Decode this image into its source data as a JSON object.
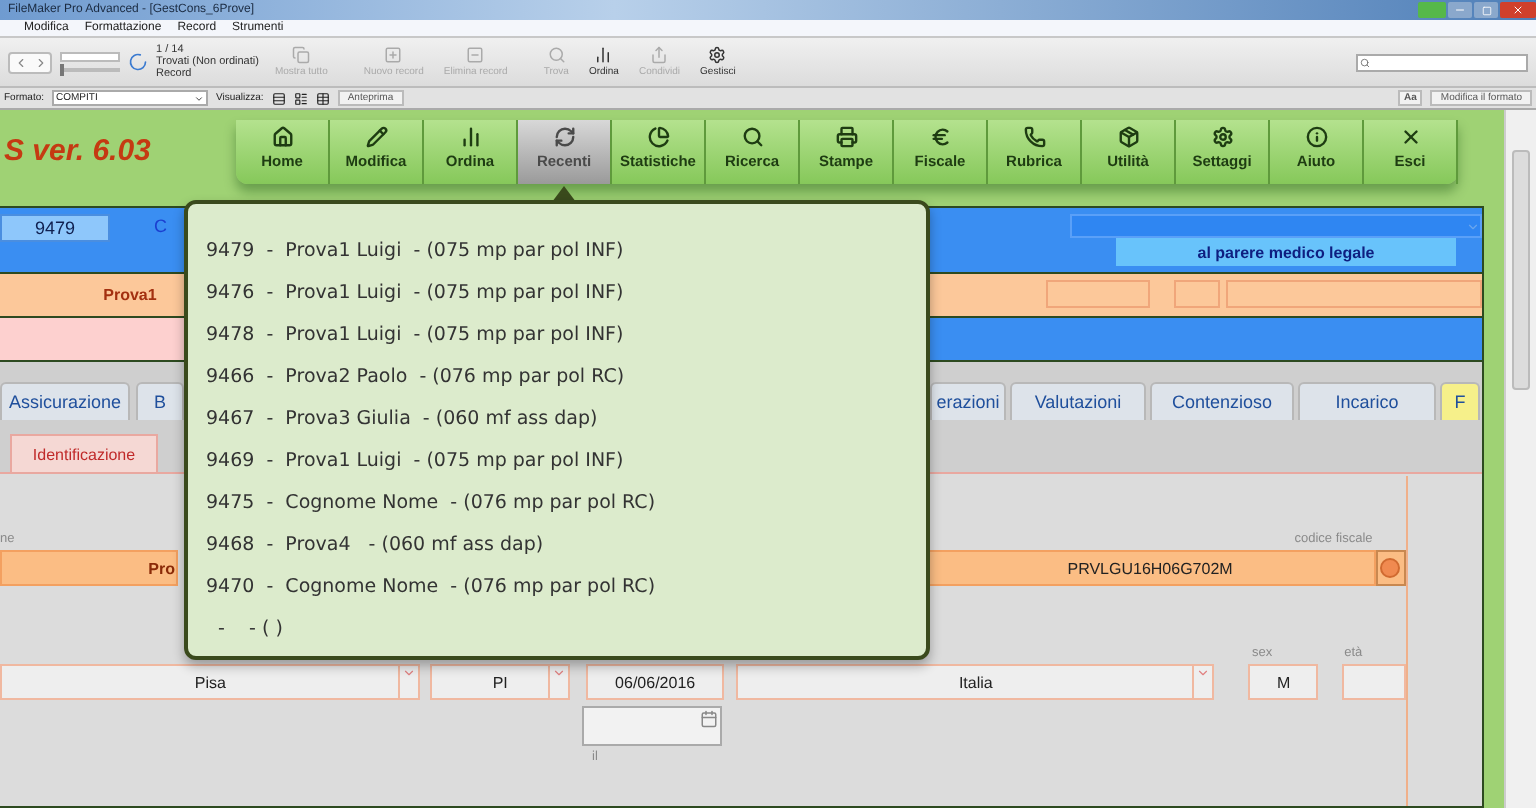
{
  "window": {
    "title": "FileMaker Pro Advanced - [GestCons_6Prove]"
  },
  "menu": [
    "Modifica",
    "Formattazione",
    "Record",
    "Strumenti"
  ],
  "toolbar": {
    "record": "1 / 14",
    "status": "Trovati (Non ordinati)",
    "record_label": "Record",
    "slider": {
      "level": 0
    },
    "buttons": [
      {
        "label": "Mostra tutto",
        "disabled": true
      },
      {
        "label": "Nuovo record",
        "disabled": true
      },
      {
        "label": "Elimina record",
        "disabled": true
      },
      {
        "label": "Trova",
        "disabled": true
      },
      {
        "label": "Ordina",
        "disabled": false
      },
      {
        "label": "Condividi",
        "disabled": true
      },
      {
        "label": "Gestisci",
        "disabled": false
      }
    ]
  },
  "format_bar": {
    "format_label": "Formato:",
    "format_value": "COMPITI",
    "view_label": "Visualizza:",
    "preview": "Anteprima",
    "font_button": "Aa",
    "edit_layout": "Modifica il formato"
  },
  "app": {
    "version": "S ver. 6.03",
    "nav": [
      {
        "label": "Home",
        "selected": false
      },
      {
        "label": "Modifica",
        "selected": false
      },
      {
        "label": "Ordina",
        "selected": false
      },
      {
        "label": "Recenti",
        "selected": true
      },
      {
        "label": "Statistiche",
        "selected": false
      },
      {
        "label": "Ricerca",
        "selected": false
      },
      {
        "label": "Stampe",
        "selected": false
      },
      {
        "label": "Fiscale",
        "selected": false
      },
      {
        "label": "Rubrica",
        "selected": false
      },
      {
        "label": "Utilità",
        "selected": false
      },
      {
        "label": "Settaggi",
        "selected": false
      },
      {
        "label": "Aiuto",
        "selected": false
      },
      {
        "label": "Esci",
        "selected": false
      }
    ]
  },
  "record_header": {
    "id": "9479",
    "label": "C",
    "note": "al parere medico legale",
    "name": "Prova1"
  },
  "tabs": [
    {
      "label": "Assicurazione",
      "selected": false
    },
    {
      "label": "B",
      "selected": false
    },
    {
      "label": "erazioni",
      "selected": false
    },
    {
      "label": "Valutazioni",
      "selected": false
    },
    {
      "label": "Contenzioso",
      "selected": false
    },
    {
      "label": "Incarico",
      "selected": false
    },
    {
      "label": "F",
      "selected": true
    }
  ],
  "subtabs": [
    {
      "label": "Identificazione",
      "selected": true
    }
  ],
  "form": {
    "name_label": "ne",
    "name_value": "Pro",
    "cf_label": "codice fiscale",
    "cf_value": "PRVLGU16H06G702M",
    "city": "Pisa",
    "province": "PI",
    "birth_date": "06/06/2016",
    "country": "Italia",
    "sex_label": "sex",
    "sex": "M",
    "age_label": "età",
    "date_label": "il"
  },
  "recent_popup": [
    "9479  -  Prova1 Luigi  - (075 mp par pol INF)",
    "9476  -  Prova1 Luigi  - (075 mp par pol INF)",
    "9478  -  Prova1 Luigi  - (075 mp par pol INF)",
    "9466  -  Prova2 Paolo  - (076 mp par pol RC)",
    "9467  -  Prova3 Giulia  - (060 mf ass dap)",
    "9469  -  Prova1 Luigi  - (075 mp par pol INF)",
    "9475  -  Cognome Nome  - (076 mp par pol RC)",
    "9468  -  Prova4   - (060 mf ass dap)",
    "9470  -  Cognome Nome  - (076 mp par pol RC)",
    "  -    - ( )"
  ]
}
